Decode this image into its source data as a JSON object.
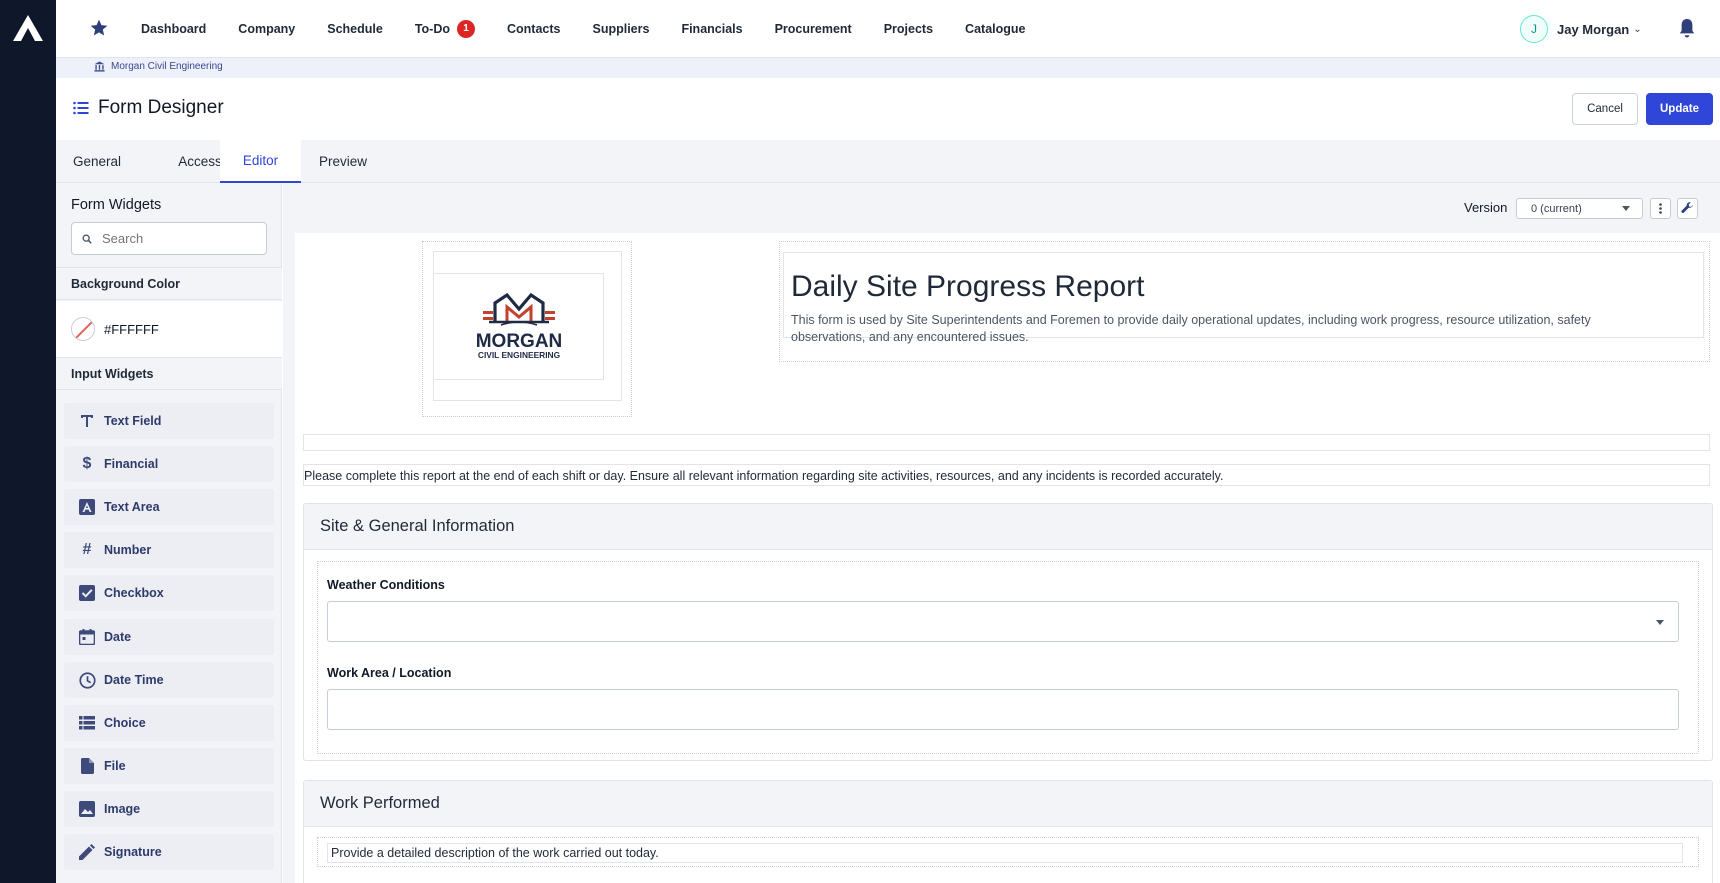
{
  "app": {
    "logo_icon": "brand-a-logo-icon",
    "nav": [
      {
        "label": "Dashboard"
      },
      {
        "label": "Company"
      },
      {
        "label": "Schedule"
      },
      {
        "label": "To-Do",
        "badge": "1"
      },
      {
        "label": "Contacts"
      },
      {
        "label": "Suppliers"
      },
      {
        "label": "Financials"
      },
      {
        "label": "Procurement"
      },
      {
        "label": "Projects"
      },
      {
        "label": "Catalogue"
      }
    ],
    "user": {
      "initial": "J",
      "name": "Jay Morgan"
    },
    "colors": {
      "rail": "#0f172a",
      "accent": "#3046d8",
      "badge": "#dc2626"
    }
  },
  "breadcrumb": {
    "company": "Morgan Civil Engineering"
  },
  "page": {
    "title": "Form Designer",
    "cancel_label": "Cancel",
    "update_label": "Update"
  },
  "tabs": [
    {
      "label": "General"
    },
    {
      "label": "Access"
    },
    {
      "label": "Editor",
      "active": true
    },
    {
      "label": "Preview"
    }
  ],
  "sidebar": {
    "title": "Form Widgets",
    "search_placeholder": "Search",
    "background_color_label": "Background Color",
    "background_color_value": "#FFFFFF",
    "input_widgets_label": "Input Widgets",
    "widgets": [
      {
        "label": "Text Field",
        "icon": "text-field-icon"
      },
      {
        "label": "Financial",
        "icon": "dollar-icon"
      },
      {
        "label": "Text Area",
        "icon": "text-area-icon"
      },
      {
        "label": "Number",
        "icon": "hash-icon"
      },
      {
        "label": "Checkbox",
        "icon": "checkbox-icon"
      },
      {
        "label": "Date",
        "icon": "calendar-icon"
      },
      {
        "label": "Date Time",
        "icon": "clock-icon"
      },
      {
        "label": "Choice",
        "icon": "list-icon"
      },
      {
        "label": "File",
        "icon": "file-icon"
      },
      {
        "label": "Image",
        "icon": "image-icon"
      },
      {
        "label": "Signature",
        "icon": "pencil-icon"
      }
    ]
  },
  "editor": {
    "version_label": "Version",
    "version_value": "0 (current)",
    "logo_text_main": "MORGAN",
    "logo_text_sub": "CIVIL ENGINEERING",
    "report_title": "Daily Site Progress Report",
    "report_description": "This form is used by Site Superintendents and Foremen to provide daily operational updates, including work progress, resource utilization, safety observations, and any encountered issues.",
    "instructions": "Please complete this report at the end of each shift or day. Ensure all relevant information regarding site activities, resources, and any incidents is recorded accurately.",
    "section1": {
      "title": "Site & General Information",
      "weather_label": "Weather Conditions",
      "location_label": "Work Area / Location"
    },
    "section2": {
      "title": "Work Performed",
      "description": "Provide a detailed description of the work carried out today."
    }
  }
}
